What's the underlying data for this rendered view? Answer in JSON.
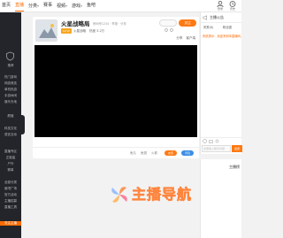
{
  "nav": {
    "items": [
      {
        "label": "首页"
      },
      {
        "label": "直播"
      },
      {
        "label": "分类"
      },
      {
        "label": "赛事"
      },
      {
        "label": "视频"
      },
      {
        "label": "游戏"
      },
      {
        "label": "鱼吧"
      }
    ],
    "icons": [
      {
        "name": "user-icon",
        "label": "登录"
      },
      {
        "name": "history-icon",
        "label": "历史"
      }
    ]
  },
  "sidebar": {
    "items": [
      {
        "label": "推荐"
      },
      {
        "label": "热门游戏"
      },
      {
        "label": "网游竞技"
      },
      {
        "label": "单机热游"
      },
      {
        "label": "手游休闲"
      },
      {
        "label": "娱乐天地"
      },
      {
        "label": "颜值"
      },
      {
        "label": "科技文化"
      },
      {
        "label": "语言互动"
      },
      {
        "label": "直播专区"
      },
      {
        "label": "正能量"
      },
      {
        "label": "户外"
      },
      {
        "label": "赛事"
      },
      {
        "label": "全部分类"
      },
      {
        "label": "鱼吧广场"
      },
      {
        "label": "官方活动"
      },
      {
        "label": "主播招募"
      },
      {
        "label": "直播工具"
      },
      {
        "label": "关注主播"
      }
    ]
  },
  "room": {
    "title": "火星战略局",
    "subtitle": "房间号1234  ·  举报  ·  分享",
    "level": "LV.12",
    "category": "火星战略",
    "viewers": "热度 3.2万",
    "share_label": "分享",
    "follow_label": "关注",
    "tools": [
      "分享",
      "客户端"
    ]
  },
  "gift_bar": {
    "items": [
      "鱼丸",
      "鱼翅",
      "火箭",
      "飞机"
    ],
    "buttons": [
      "充值",
      "背包"
    ]
  },
  "chat": {
    "title": "主播公告",
    "tabs": [
      "贵宾(0)",
      "粉丝团"
    ],
    "notice": "系统提示：欢迎来到本直播间，请文明发言",
    "input_placeholder": "这里输入聊天内容",
    "send_label": "发送"
  },
  "rank": {
    "title": "主播榜"
  },
  "watermark": {
    "text": "主播导航"
  },
  "colors": {
    "accent": "#ff6a00",
    "sidebar_bg": "#24252a",
    "player_bg": "#000000"
  }
}
